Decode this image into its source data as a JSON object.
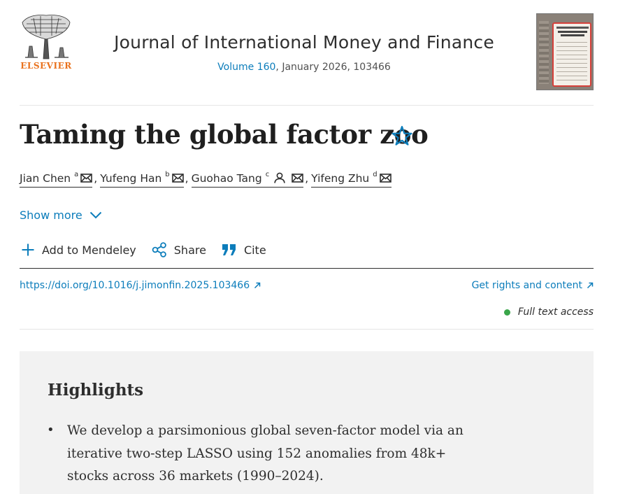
{
  "header": {
    "publisher_name": "ELSEVIER",
    "journal_title": "Journal of International Money and Finance",
    "issue": {
      "volume_link": "Volume 160",
      "rest": ", January 2026, 103466"
    },
    "cover_alt": "Journal of International Money and Finance cover"
  },
  "article": {
    "title": "Taming the global factor zoo",
    "authors": [
      {
        "name": "Jian Chen",
        "affiliation": "a"
      },
      {
        "name": "Yufeng Han",
        "affiliation": "b"
      },
      {
        "name": "Guohao Tang",
        "affiliation": "c"
      },
      {
        "name": "Yifeng Zhu",
        "affiliation": "d"
      }
    ],
    "separator": ",",
    "show_more": "Show more"
  },
  "toolbar": {
    "mendeley": "Add to Mendeley",
    "share": "Share",
    "cite": "Cite"
  },
  "links": {
    "doi": "https://doi.org/10.1016/j.jimonfin.2025.103466",
    "rights": "Get rights and content",
    "access": "Full text access"
  },
  "highlights": {
    "title": "Highlights",
    "items": [
      "We develop a parsimonious global seven-factor model via an iterative two-step LASSO using 152 anomalies from 48k+ stocks across 36 markets (1990–2024)."
    ]
  },
  "colors": {
    "link": "#0c7dbb",
    "publisher_orange": "#e9711c",
    "access_green": "#3aa64a",
    "highlight_bg": "#f2f2f2"
  }
}
